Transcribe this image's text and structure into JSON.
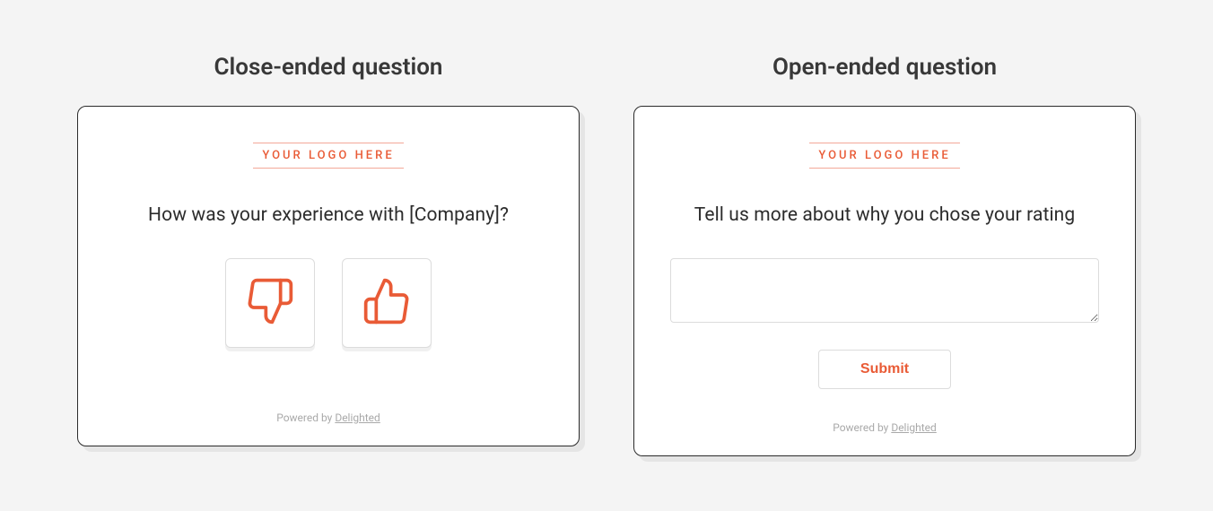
{
  "left": {
    "heading": "Close-ended question",
    "logo_placeholder": "YOUR LOGO HERE",
    "question": "How was your experience with [Company]?",
    "footer_prefix": "Powered by ",
    "footer_link": "Delighted"
  },
  "right": {
    "heading": "Open-ended question",
    "logo_placeholder": "YOUR LOGO HERE",
    "question": "Tell us more about why you chose your rating",
    "submit_label": "Submit",
    "footer_prefix": "Powered by ",
    "footer_link": "Delighted"
  },
  "colors": {
    "accent": "#e95b36"
  }
}
